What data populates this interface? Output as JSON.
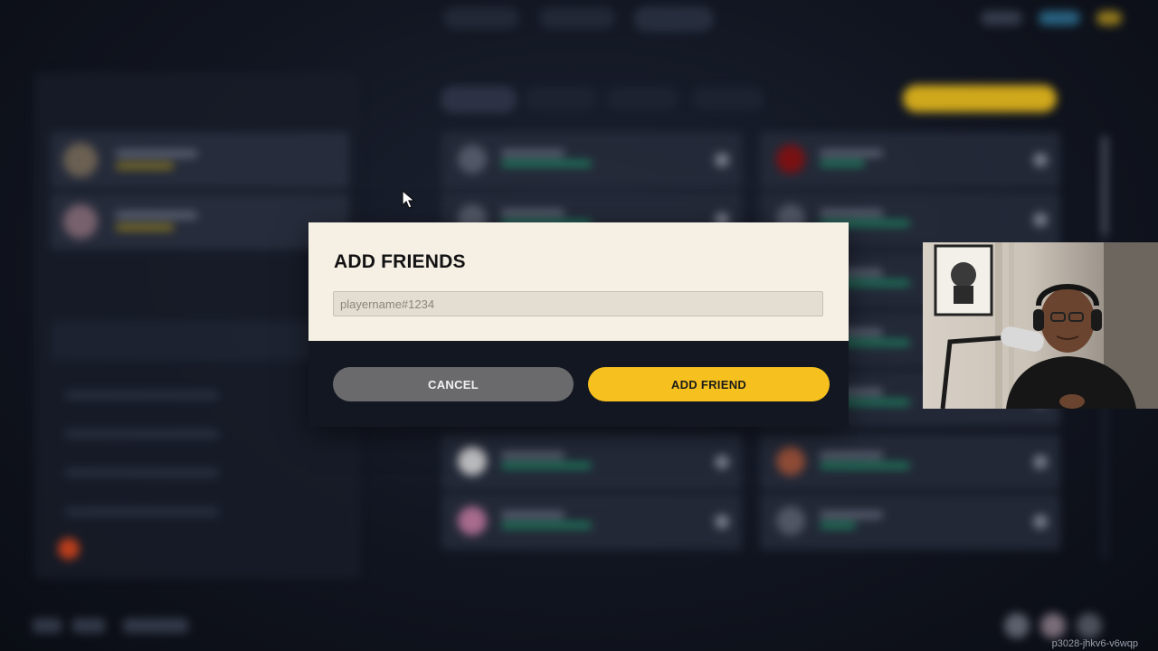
{
  "modal": {
    "title": "ADD FRIENDS",
    "input_value": "",
    "input_placeholder": "playername#1234",
    "cancel_label": "CANCEL",
    "add_label": "ADD FRIEND"
  },
  "colors": {
    "modal_background": "#f5efe4",
    "modal_footer": "#131722",
    "accent_yellow": "#f6c11e",
    "cancel_gray": "#6a6a6c",
    "online_green": "#1f9d6d"
  },
  "icons": [
    "cursor-arrow-icon"
  ],
  "overlay": {
    "watermark": "p3028-jhkv6-v6wqp"
  }
}
